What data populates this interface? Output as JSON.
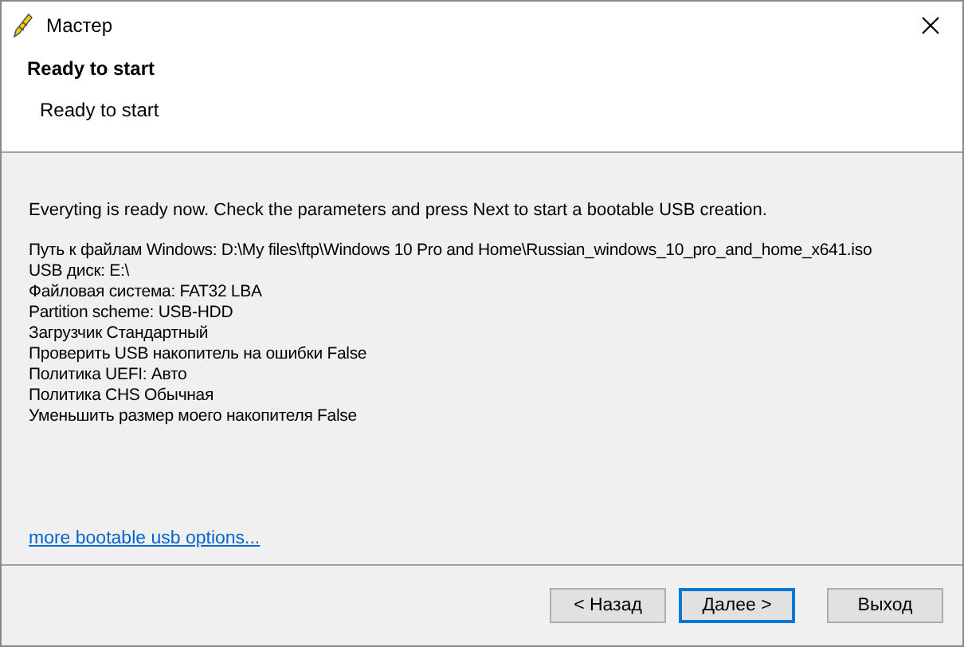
{
  "window": {
    "title": "Мастер"
  },
  "header": {
    "title": "Ready to start",
    "subtitle": "Ready to start"
  },
  "intro": "Everyting is ready now. Check the parameters and press Next to start a bootable USB creation.",
  "parameters": [
    "Путь к файлам Windows: D:\\My files\\ftp\\Windows 10 Pro and Home\\Russian_windows_10_pro_and_home_x641.iso",
    "USB диск: E:\\",
    "Файловая система: FAT32 LBA",
    "Partition scheme: USB-HDD",
    "Загрузчик Стандартный",
    "Проверить USB накопитель на ошибки False",
    "Политика UEFI: Авто",
    "Политика CHS Обычная",
    "Уменьшить размер моего накопителя False"
  ],
  "link": "more bootable usb options...",
  "buttons": [
    {
      "label": "< Назад",
      "default": false
    },
    {
      "label": "Далее >",
      "default": true
    },
    {
      "label": "Выход",
      "default": false
    }
  ]
}
